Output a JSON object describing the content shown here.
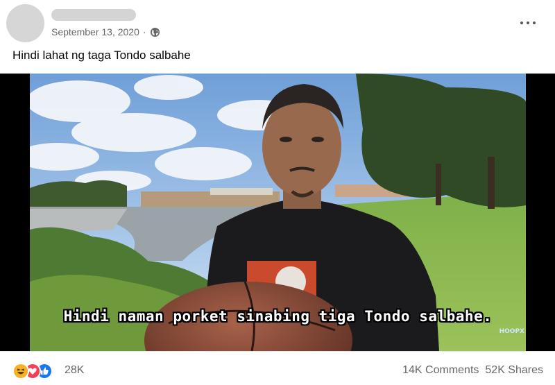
{
  "post": {
    "date": "September 13, 2020",
    "separator": "·",
    "caption": "Hindi lahat ng taga Tondo salbahe"
  },
  "media": {
    "subtitle": "Hindi naman porket sinabing tiga Tondo salbahe.",
    "watermark": "HOOPX"
  },
  "footer": {
    "reactions": [
      "haha-icon",
      "love-icon",
      "like-icon"
    ],
    "reaction_count": "28K",
    "comments": "14K Comments",
    "shares": "52K Shares"
  },
  "colors": {
    "meta_text": "#65676b",
    "like": "#1877f2",
    "love": "#f33e58",
    "haha": "#f7b125"
  }
}
